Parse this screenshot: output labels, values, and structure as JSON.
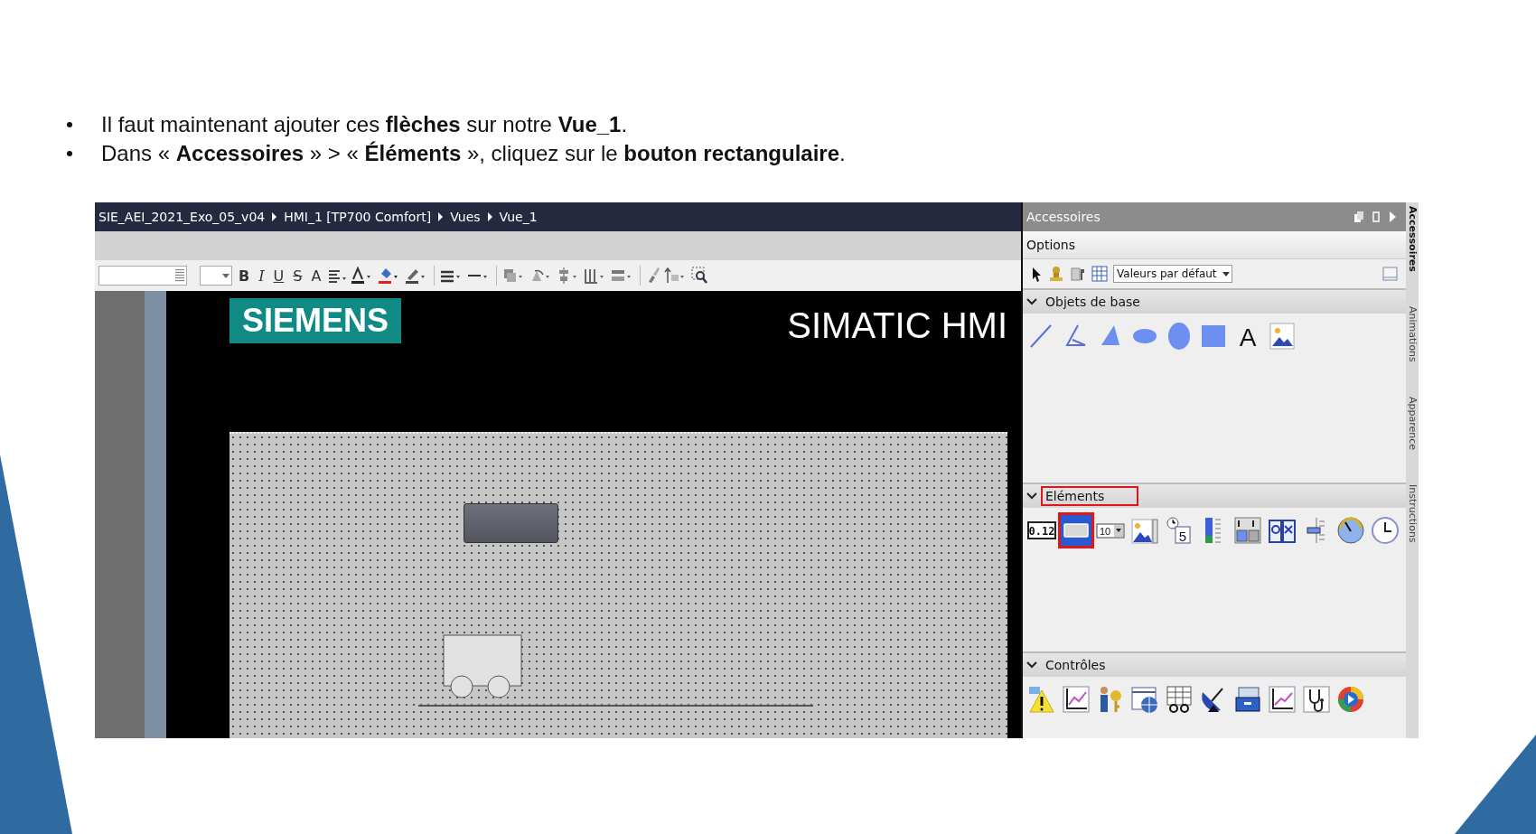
{
  "slide": {
    "bullets": [
      "Il faut maintenant ajouter ces **flèches** sur notre **Vue_1**.",
      "Dans « **Accessoires** » > « **Éléments** », cliquez sur le **bouton rectangulaire**."
    ]
  },
  "breadcrumb": [
    "SIE_AEI_2021_Exo_05_v04",
    "HMI_1 [TP700 Comfort]",
    "Vues",
    "Vue_1"
  ],
  "format_buttons": [
    {
      "kind": "bold",
      "label": "B"
    },
    {
      "kind": "italic",
      "label": "I"
    },
    {
      "kind": "underline",
      "label": "U"
    },
    {
      "kind": "strike",
      "label": "S"
    },
    {
      "kind": "grow",
      "label": "A"
    }
  ],
  "hmi_screen": {
    "logo": "SIEMENS",
    "title": "SIMATIC HMI"
  },
  "panel": {
    "title": "Accessoires",
    "options_label": "Options",
    "style_select": "Valeurs par défaut",
    "sections": [
      {
        "title": "Objets de base",
        "expanded": true,
        "highlighted": false,
        "items": [
          {
            "kind": "line",
            "selected": false,
            "highlighted": false
          },
          {
            "kind": "polyline",
            "selected": false,
            "highlighted": false
          },
          {
            "kind": "polygon",
            "selected": false,
            "highlighted": false
          },
          {
            "kind": "ellipse",
            "selected": false,
            "highlighted": false
          },
          {
            "kind": "circle",
            "selected": false,
            "highlighted": false
          },
          {
            "kind": "rectangle",
            "selected": false,
            "highlighted": false
          },
          {
            "kind": "text",
            "label": "A",
            "selected": false,
            "highlighted": false
          },
          {
            "kind": "image",
            "selected": false,
            "highlighted": false
          }
        ]
      },
      {
        "title": "Eléments",
        "expanded": true,
        "highlighted": true,
        "items": [
          {
            "kind": "io",
            "label": "0.12",
            "selected": false,
            "highlighted": false
          },
          {
            "kind": "button",
            "selected": true,
            "highlighted": true
          },
          {
            "kind": "symbolic",
            "label": "10",
            "selected": false,
            "highlighted": false
          },
          {
            "kind": "graphic",
            "selected": false,
            "highlighted": false
          },
          {
            "kind": "date",
            "label": "5",
            "selected": false,
            "highlighted": false
          },
          {
            "kind": "bar",
            "selected": false,
            "highlighted": false
          },
          {
            "kind": "switch",
            "selected": false,
            "highlighted": false
          },
          {
            "kind": "library",
            "selected": false,
            "highlighted": false
          },
          {
            "kind": "slider",
            "selected": false,
            "highlighted": false
          },
          {
            "kind": "gauge",
            "selected": false,
            "highlighted": false
          },
          {
            "kind": "clock",
            "selected": false,
            "highlighted": false
          }
        ]
      },
      {
        "title": "Contrôles",
        "expanded": true,
        "highlighted": false,
        "items": [
          {
            "kind": "alarm",
            "selected": false,
            "highlighted": false
          },
          {
            "kind": "trend",
            "selected": false,
            "highlighted": false
          },
          {
            "kind": "user",
            "selected": false,
            "highlighted": false
          },
          {
            "kind": "browser",
            "selected": false,
            "highlighted": false
          },
          {
            "kind": "recipe",
            "selected": false,
            "highlighted": false
          },
          {
            "kind": "dish",
            "selected": false,
            "highlighted": false
          },
          {
            "kind": "drawer",
            "selected": false,
            "highlighted": false
          },
          {
            "kind": "fxy",
            "selected": false,
            "highlighted": false
          },
          {
            "kind": "stethoscope",
            "selected": false,
            "highlighted": false
          },
          {
            "kind": "player",
            "selected": false,
            "highlighted": false
          }
        ]
      }
    ]
  },
  "side_tabs": [
    {
      "label": "Accessoires",
      "selected": true
    },
    {
      "label": "Animations",
      "selected": false
    },
    {
      "label": "Apparence",
      "selected": false
    },
    {
      "label": "Instructions",
      "selected": false
    }
  ]
}
